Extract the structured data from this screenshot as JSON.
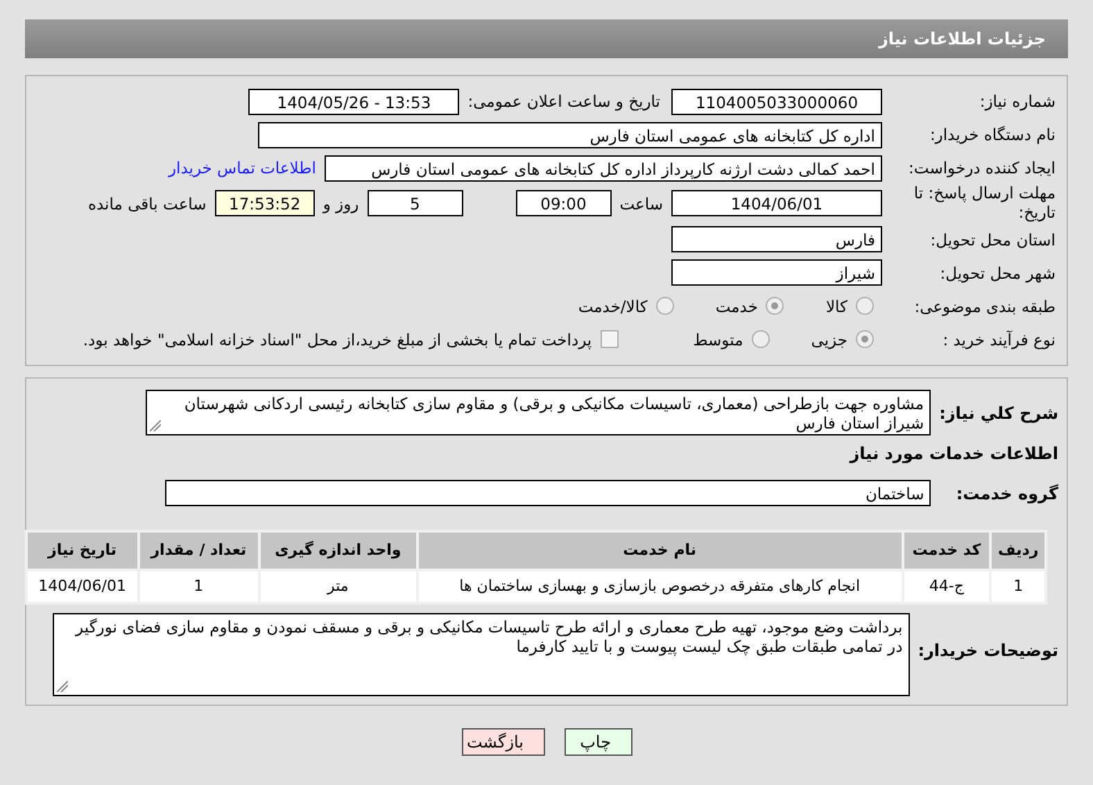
{
  "header": {
    "title": "جزئیات اطلاعات نیاز"
  },
  "details": {
    "need_number": {
      "label": "شماره نیاز:",
      "value": "1104005033000060"
    },
    "announce": {
      "label": "تاریخ و ساعت اعلان عمومی:",
      "value": "1404/05/26 - 13:53"
    },
    "buyer": {
      "label": "نام دستگاه خریدار:",
      "value": "اداره کل کتابخانه های عمومی استان فارس"
    },
    "requester": {
      "label": "ایجاد کننده درخواست:",
      "value": "احمد  کمالی دشت ارژنه  کارپرداز اداره کل کتابخانه های عمومی استان فارس",
      "link": "اطلاعات تماس خریدار"
    },
    "deadline": {
      "label": "مهلت ارسال پاسخ: تا تاریخ:",
      "date": "1404/06/01",
      "time_label": "ساعت",
      "time": "09:00",
      "days": "5",
      "days_label": "روز و",
      "remaining": "17:53:52",
      "remaining_label": "ساعت باقی مانده"
    },
    "province": {
      "label": "استان محل تحویل:",
      "value": "فارس"
    },
    "city": {
      "label": "شهر محل تحویل:",
      "value": "شیراز"
    },
    "category": {
      "label": "طبقه بندی موضوعی:",
      "options": [
        {
          "label": "کالا",
          "selected": false
        },
        {
          "label": "خدمت",
          "selected": true
        },
        {
          "label": "کالا/خدمت",
          "selected": false
        }
      ]
    },
    "process": {
      "label": "نوع فرآیند خرید :",
      "options": [
        {
          "label": "جزیی",
          "selected": true
        },
        {
          "label": "متوسط",
          "selected": false
        }
      ],
      "payment": {
        "checked": false,
        "text": "پرداخت تمام یا بخشی از مبلغ خرید،از محل \"اسناد خزانه اسلامی\" خواهد بود."
      }
    }
  },
  "needs": {
    "summary": {
      "label": "شرح کلي نياز:",
      "value": "مشاوره جهت بازطراحی (معماری، تاسیسات مکانیکی و برقی) و مقاوم سازی کتابخانه رئیسی اردکانی شهرستان شیراز استان فارس"
    },
    "section_title": "اطلاعات خدمات مورد نیاز",
    "service_group": {
      "label": "گروه خدمت:",
      "value": "ساختمان"
    },
    "table": {
      "columns": [
        "ردیف",
        "کد خدمت",
        "نام خدمت",
        "واحد اندازه گیری",
        "تعداد / مقدار",
        "تاریخ نیاز"
      ],
      "rows": [
        [
          "1",
          "ج-44",
          "انجام کارهای متفرقه درخصوص بازسازی و بهسازی ساختمان ها",
          "متر",
          "1",
          "1404/06/01"
        ]
      ]
    },
    "buyer_notes": {
      "label": "توضیحات خریدار:",
      "value": "برداشت وضع موجود، تهیه طرح معماری و ارائه طرح تاسیسات مکانیکی و برقی و مسقف نمودن و مقاوم سازی فضای نورگیر در تمامی طبقات طبق چک لیست پیوست  و با تایید کارفرما"
    }
  },
  "buttons": [
    {
      "label": "چاپ",
      "kind": "print"
    },
    {
      "label": "بازگشت",
      "kind": "back"
    }
  ]
}
